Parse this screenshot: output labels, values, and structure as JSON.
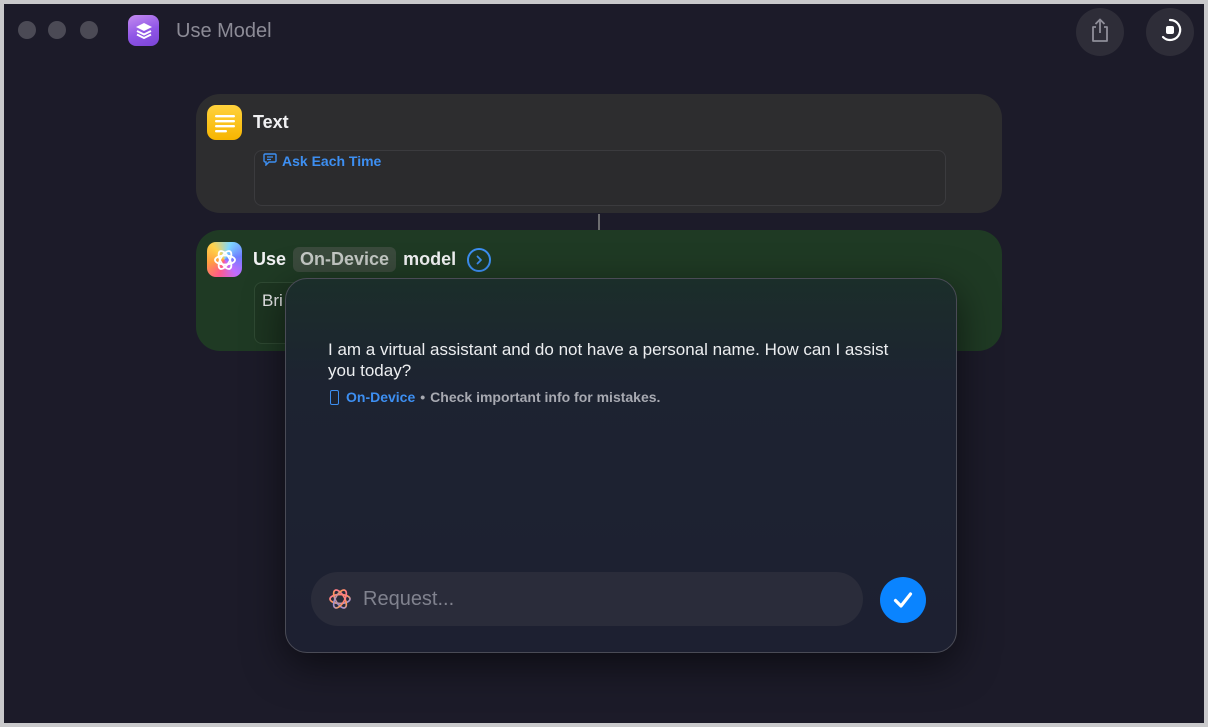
{
  "window": {
    "title": "Use Model"
  },
  "text_action": {
    "title": "Text",
    "token": "Ask Each Time"
  },
  "model_action": {
    "prefix": "Use",
    "model": "On-Device",
    "suffix": "model",
    "prompt_preview": "Bri"
  },
  "response_panel": {
    "response": "I am a virtual assistant and do not have a personal name. How can I assist you today?",
    "model_label": "On-Device",
    "separator": "•",
    "disclaimer": "Check important info for mistakes.",
    "input_placeholder": "Request..."
  },
  "colors": {
    "accent": "#0a84ff",
    "link_blue": "#3d8ff2",
    "text_action_bg": "#2d2d2f",
    "model_action_bg": "#1f3a24",
    "window_bg": "#1c1b29"
  },
  "icons": {
    "app": "shortcuts-icon",
    "text_action": "text-lines-icon",
    "model_action": "apple-intelligence-icon",
    "share": "share-icon",
    "run": "run-progress-icon",
    "submit": "checkmark-icon"
  }
}
